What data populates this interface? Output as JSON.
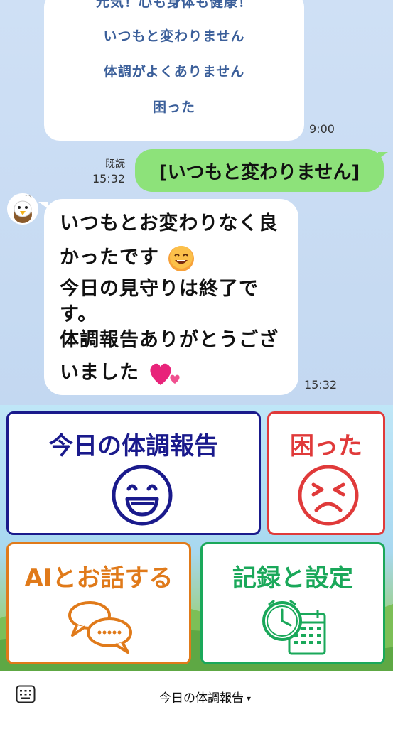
{
  "chat": {
    "choice_card": {
      "options": [
        "元気！心も身体も健康！",
        "いつもと変わりません",
        "体調がよくありません",
        "困った"
      ],
      "time": "9:00"
    },
    "sent_message": {
      "text": "[いつもと変わりません]",
      "read_label": "既読",
      "time": "15:32"
    },
    "reply_message": {
      "lines": [
        "いつもとお変わりなく良",
        "かったです",
        "今日の見守りは終了で",
        "す。",
        "体調報告ありがとうござ",
        "いました"
      ],
      "time": "15:32"
    }
  },
  "menu": {
    "tiles": [
      {
        "label": "今日の体調報告",
        "color": "#1a1a8c",
        "icon": "smile-face-icon"
      },
      {
        "label": "困った",
        "color": "#e03a3a",
        "icon": "sad-face-icon"
      },
      {
        "label": "AIとお話する",
        "color": "#e07a1a",
        "icon": "speech-bubbles-icon"
      },
      {
        "label": "記録と設定",
        "color": "#1aa85a",
        "icon": "clock-calendar-icon"
      }
    ]
  },
  "bottom_bar": {
    "menu_label": "今日の体調報告",
    "arrow": "▾"
  }
}
